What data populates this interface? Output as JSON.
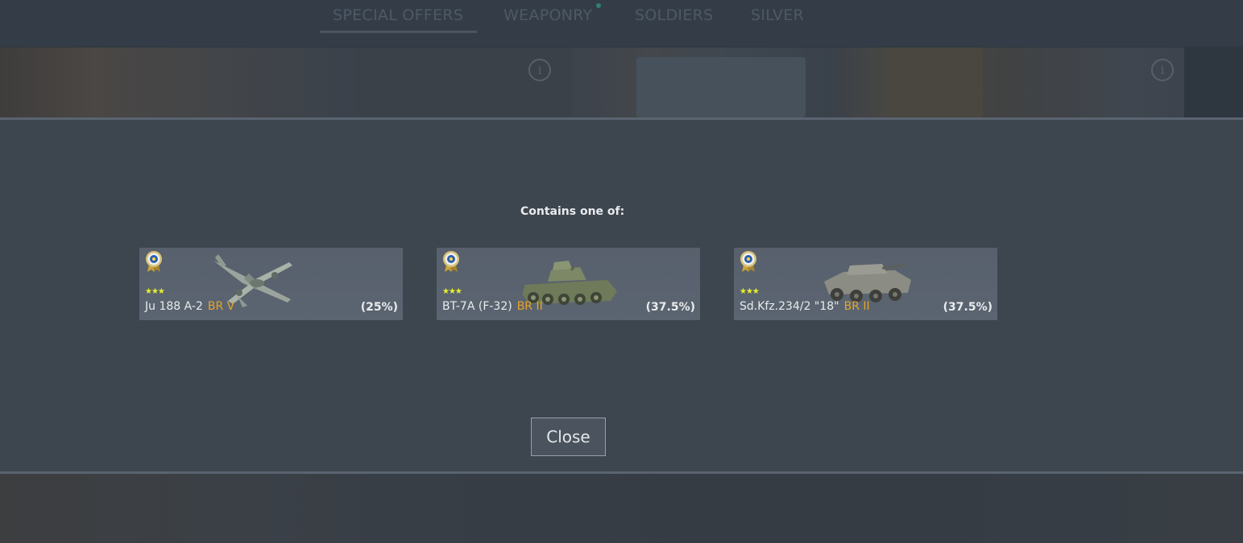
{
  "tabs": [
    {
      "label": "SPECIAL OFFERS",
      "active": true
    },
    {
      "label": "WEAPONRY",
      "has_notification": true
    },
    {
      "label": "SOLDIERS"
    },
    {
      "label": "SILVER"
    }
  ],
  "modal": {
    "heading": "Contains one of:",
    "items": [
      {
        "name": "Ju 188 A-2",
        "br": "BR V",
        "chance": "(25%)",
        "stars": "★★★",
        "type_icon": "plane"
      },
      {
        "name": "BT-7A (F-32)",
        "br": "BR II",
        "chance": "(37.5%)",
        "stars": "★★★",
        "type_icon": "tank"
      },
      {
        "name": "Sd.Kfz.234/2 \"18\"",
        "br": "BR II",
        "chance": "(37.5%)",
        "stars": "★★★",
        "type_icon": "armored-car"
      }
    ],
    "close_label": "Close"
  },
  "colors": {
    "br_text": "#e5a52a",
    "stars": "#e8f02a",
    "card_bg": "#59636f",
    "modal_bg": "#3d454f"
  }
}
